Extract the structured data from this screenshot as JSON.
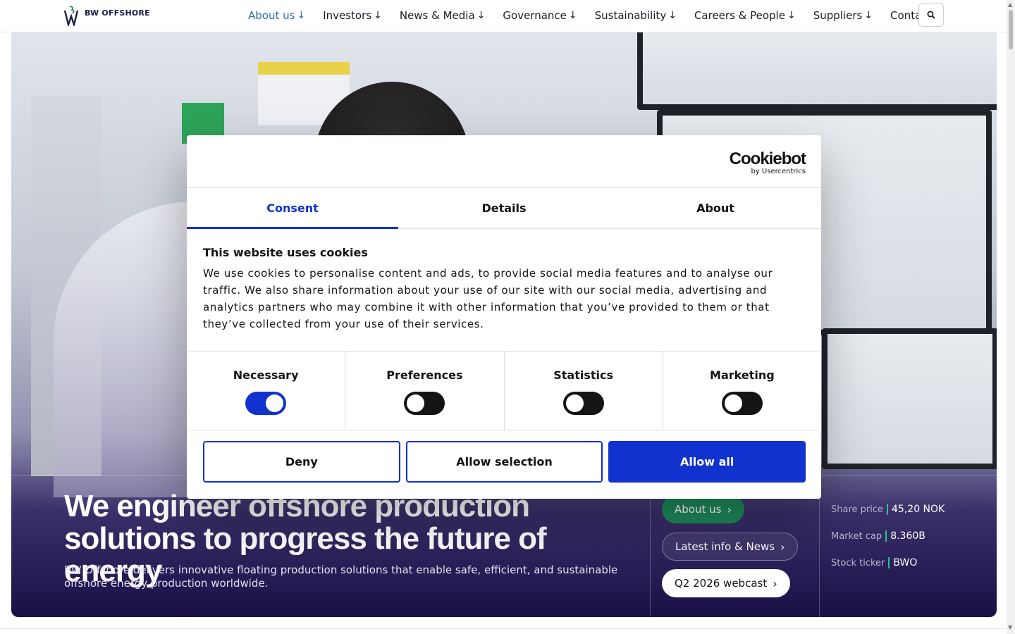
{
  "header": {
    "logo_text": "BW OFFSHORE",
    "nav": [
      {
        "label": "About us",
        "arrow": "↓"
      },
      {
        "label": "Investors",
        "arrow": "↓"
      },
      {
        "label": "News & Media",
        "arrow": "↓"
      },
      {
        "label": "Governance",
        "arrow": "↓"
      },
      {
        "label": "Sustainability",
        "arrow": "↓"
      },
      {
        "label": "Careers & People",
        "arrow": "↓"
      },
      {
        "label": "Suppliers",
        "arrow": "↓"
      },
      {
        "label": "Contact"
      }
    ],
    "search_icon": "search-icon"
  },
  "hero": {
    "title": "We engineer offshore production solutions to progress the future of energy",
    "subtitle": "BW Offshore delivers innovative floating production solutions that enable safe, efficient, and sustainable offshore energy production worldwide.",
    "ctas": {
      "about": "About us",
      "news": "Latest info & News",
      "webcast": "Q2 2026 webcast"
    },
    "stats": [
      {
        "label": "Share price",
        "value": "45,20 NOK"
      },
      {
        "label": "Market cap",
        "value": "8.360B"
      },
      {
        "label": "Stock ticker",
        "value": "BWO"
      }
    ]
  },
  "cookie_dialog": {
    "brand": "Cookiebot",
    "brand_sub": "by Usercentrics",
    "tabs": [
      {
        "label": "Consent",
        "active": true
      },
      {
        "label": "Details",
        "active": false
      },
      {
        "label": "About",
        "active": false
      }
    ],
    "title": "This website uses cookies",
    "text": "We use cookies to personalise content and ads, to provide social media features and to analyse our traffic. We also share information about your use of our site with our social media, advertising and analytics partners who may combine it with other information that you’ve provided to them or that they’ve collected from your use of their services.",
    "categories": [
      {
        "label": "Necessary",
        "enabled": true
      },
      {
        "label": "Preferences",
        "enabled": false
      },
      {
        "label": "Statistics",
        "enabled": false
      },
      {
        "label": "Marketing",
        "enabled": false
      }
    ],
    "buttons": {
      "deny": "Deny",
      "allow_selection": "Allow selection",
      "allow_all": "Allow all"
    }
  },
  "colors": {
    "accent_blue": "#1032cf",
    "brand_navy": "#1b1b4e",
    "cta_green": "#1d8a5a",
    "nav_active": "#2a6fa6",
    "stat_sep": "#28c08a"
  }
}
